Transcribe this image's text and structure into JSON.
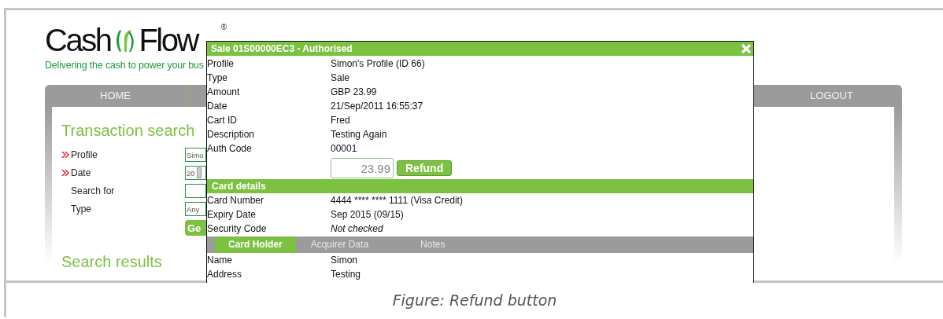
{
  "logo": {
    "word_1": "Cash",
    "word_2": "Flow",
    "mark": "®",
    "tagline": "Delivering the cash to power your bus"
  },
  "nav": [
    {
      "label": "HOME"
    },
    {
      "label": "LOGOUT"
    }
  ],
  "search": {
    "title": "Transaction search",
    "fields": [
      {
        "label": "Profile",
        "required": true,
        "kind": "select",
        "value": "Simo"
      },
      {
        "label": "Date",
        "required": true,
        "kind": "date",
        "value": "20"
      },
      {
        "label": "Search for",
        "required": false,
        "kind": "text"
      },
      {
        "label": "Type",
        "required": false,
        "kind": "select",
        "value": "Any"
      }
    ],
    "go_button": "Ge"
  },
  "results_title": "Search results",
  "dialog": {
    "title": "Sale 01S00000EC3 - Authorised",
    "rows": [
      {
        "label": "Profile",
        "value": "Simon's Profile (ID 66)"
      },
      {
        "label": "Type",
        "value": "Sale"
      },
      {
        "label": "Amount",
        "value": "GBP 23.99"
      },
      {
        "label": "Date",
        "value": "21/Sep/2011 16:55:37"
      },
      {
        "label": "Cart ID",
        "value": "Fred"
      },
      {
        "label": "Description",
        "value": "Testing Again"
      },
      {
        "label": "Auth Code",
        "value": "00001"
      }
    ],
    "refund": {
      "amount": "23.99",
      "button": "Refund"
    },
    "card_section": "Card details",
    "card_rows": [
      {
        "label": "Card Number",
        "value": "4444 **** **** 1111 (Visa Credit)",
        "emphasis": false
      },
      {
        "label": "Expiry Date",
        "value": "Sep 2015 (09/15)",
        "emphasis": false
      },
      {
        "label": "Security Code",
        "value": "Not checked",
        "emphasis": true
      }
    ],
    "tabs": [
      {
        "label": "Card Holder",
        "selected": true
      },
      {
        "label": "Acquirer Data",
        "selected": false
      },
      {
        "label": "Notes",
        "selected": false
      }
    ],
    "holder_rows": [
      {
        "label": "Name",
        "value": "Simon"
      },
      {
        "label": "Address",
        "value": "Testing"
      }
    ]
  },
  "caption": "Figure: Refund button"
}
